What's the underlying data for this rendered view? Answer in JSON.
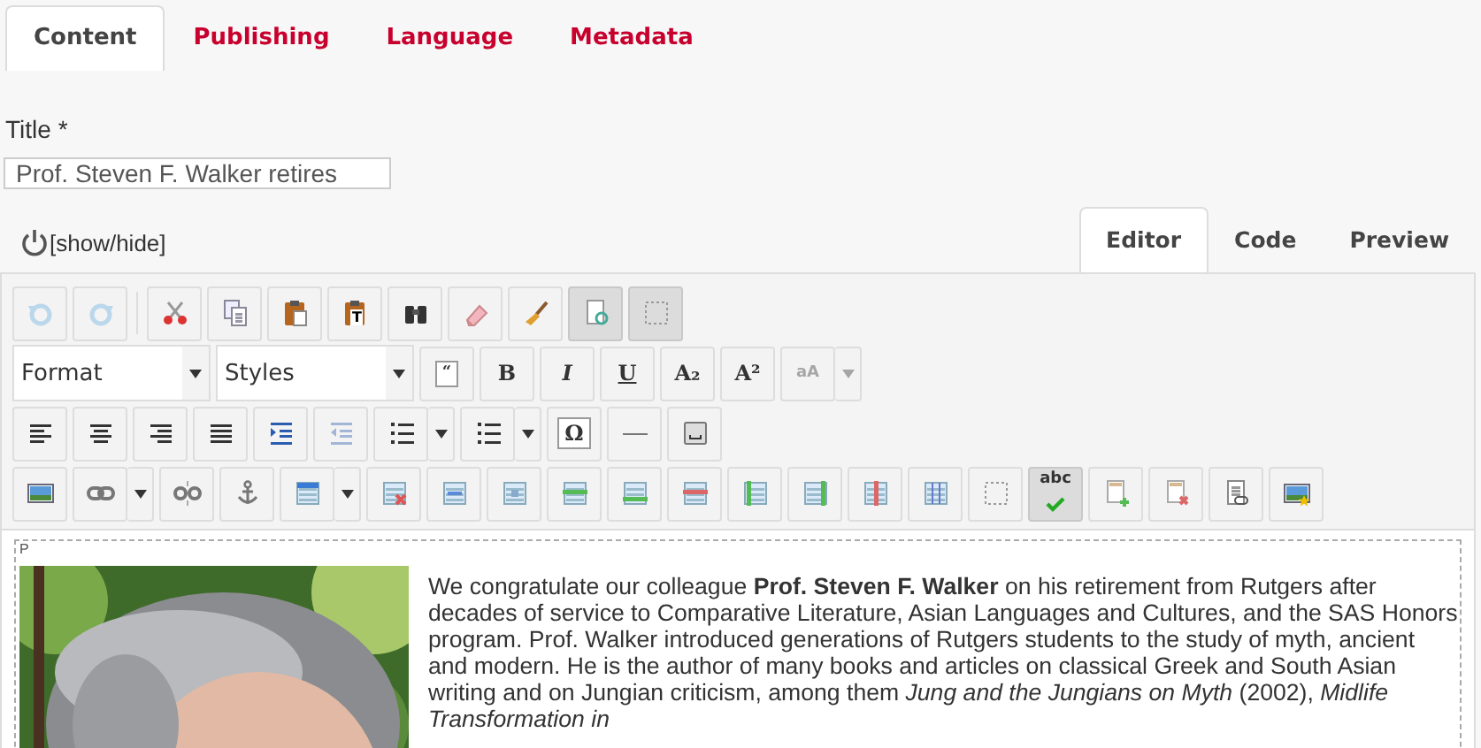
{
  "tabs": [
    {
      "label": "Content",
      "selected": true
    },
    {
      "label": "Publishing",
      "selected": false
    },
    {
      "label": "Language",
      "selected": false
    },
    {
      "label": "Metadata",
      "selected": false
    }
  ],
  "title_field": {
    "label": "Title *",
    "value": "Prof. Steven F. Walker retires"
  },
  "toggle": {
    "label": "[show/hide]"
  },
  "editor_tabs": [
    {
      "label": "Editor",
      "selected": true
    },
    {
      "label": "Code",
      "selected": false
    },
    {
      "label": "Preview",
      "selected": false
    }
  ],
  "toolbar": [
    [
      {
        "kind": "button",
        "on": false,
        "disabled": true
      },
      {
        "kind": "button",
        "on": false,
        "disabled": true
      },
      {
        "kind": "separator"
      },
      {
        "kind": "button",
        "on": false,
        "disabled": false
      },
      {
        "kind": "button",
        "on": false,
        "disabled": false
      },
      {
        "kind": "button",
        "on": false,
        "disabled": false
      },
      {
        "kind": "button",
        "on": false,
        "disabled": false,
        "glyph": "T"
      },
      {
        "kind": "button",
        "on": false,
        "disabled": false
      },
      {
        "kind": "button",
        "on": false,
        "disabled": false
      },
      {
        "kind": "button",
        "on": false,
        "disabled": false
      },
      {
        "kind": "button",
        "on": true,
        "disabled": false
      },
      {
        "kind": "button",
        "on": true,
        "disabled": false
      }
    ],
    [
      {
        "kind": "combo",
        "label": "Format"
      },
      {
        "kind": "combo",
        "label": "Styles"
      },
      {
        "kind": "button",
        "on": false,
        "disabled": false,
        "glyph": "“"
      },
      {
        "kind": "button",
        "on": false,
        "disabled": false,
        "glyph": "B"
      },
      {
        "kind": "button",
        "on": false,
        "disabled": false,
        "glyph": "I"
      },
      {
        "kind": "button",
        "on": false,
        "disabled": false,
        "glyph": "U"
      },
      {
        "kind": "button",
        "on": false,
        "disabled": false,
        "glyph": "A₂"
      },
      {
        "kind": "button",
        "on": false,
        "disabled": false,
        "glyph": "A²"
      },
      {
        "kind": "split",
        "on": false,
        "disabled": true,
        "glyph": "aA"
      }
    ],
    [
      {
        "kind": "button",
        "on": false,
        "disabled": false
      },
      {
        "kind": "button",
        "on": false,
        "disabled": false
      },
      {
        "kind": "button",
        "on": false,
        "disabled": false
      },
      {
        "kind": "button",
        "on": false,
        "disabled": false
      },
      {
        "kind": "button",
        "on": false,
        "disabled": false
      },
      {
        "kind": "button",
        "on": false,
        "disabled": true
      },
      {
        "kind": "split",
        "on": false,
        "disabled": false
      },
      {
        "kind": "split",
        "on": false,
        "disabled": false
      },
      {
        "kind": "button",
        "on": false,
        "disabled": false,
        "glyph": "Ω"
      },
      {
        "kind": "button",
        "on": false,
        "disabled": false
      },
      {
        "kind": "button",
        "on": false,
        "disabled": false
      }
    ],
    [
      {
        "kind": "button",
        "on": false,
        "disabled": false
      },
      {
        "kind": "split",
        "on": false,
        "disabled": false
      },
      {
        "kind": "button",
        "on": false,
        "disabled": false
      },
      {
        "kind": "button",
        "on": false,
        "disabled": false
      },
      {
        "kind": "split",
        "on": false,
        "disabled": false
      },
      {
        "kind": "button",
        "on": false,
        "disabled": false
      },
      {
        "kind": "button",
        "on": false,
        "disabled": false
      },
      {
        "kind": "button",
        "on": false,
        "disabled": false
      },
      {
        "kind": "button",
        "on": false,
        "disabled": false
      },
      {
        "kind": "button",
        "on": false,
        "disabled": false
      },
      {
        "kind": "button",
        "on": false,
        "disabled": false
      },
      {
        "kind": "button",
        "on": false,
        "disabled": false
      },
      {
        "kind": "button",
        "on": false,
        "disabled": false
      },
      {
        "kind": "button",
        "on": false,
        "disabled": false
      },
      {
        "kind": "button",
        "on": false,
        "disabled": false
      },
      {
        "kind": "button",
        "on": false,
        "disabled": false
      },
      {
        "kind": "button",
        "on": true,
        "disabled": false,
        "glyph": "abc"
      },
      {
        "kind": "button",
        "on": false,
        "disabled": false
      },
      {
        "kind": "button",
        "on": false,
        "disabled": false
      },
      {
        "kind": "button",
        "on": false,
        "disabled": false
      },
      {
        "kind": "button",
        "on": false,
        "disabled": false
      }
    ]
  ],
  "content": {
    "block_label": "P",
    "paragraph": "We congratulate our colleague **Prof. Steven F. Walker** on his retirement from Rutgers after decades of service to Comparative Literature, Asian Languages and Cultures, and the SAS Honors program. Prof. Walker introduced generations of Rutgers students to the study of myth, ancient and modern. He is the author of many books and articles on classical Greek and South Asian writing and on Jungian criticism, among them *Jung and the Jungians on Myth* (2002), *Midlife Transformation in*"
  }
}
